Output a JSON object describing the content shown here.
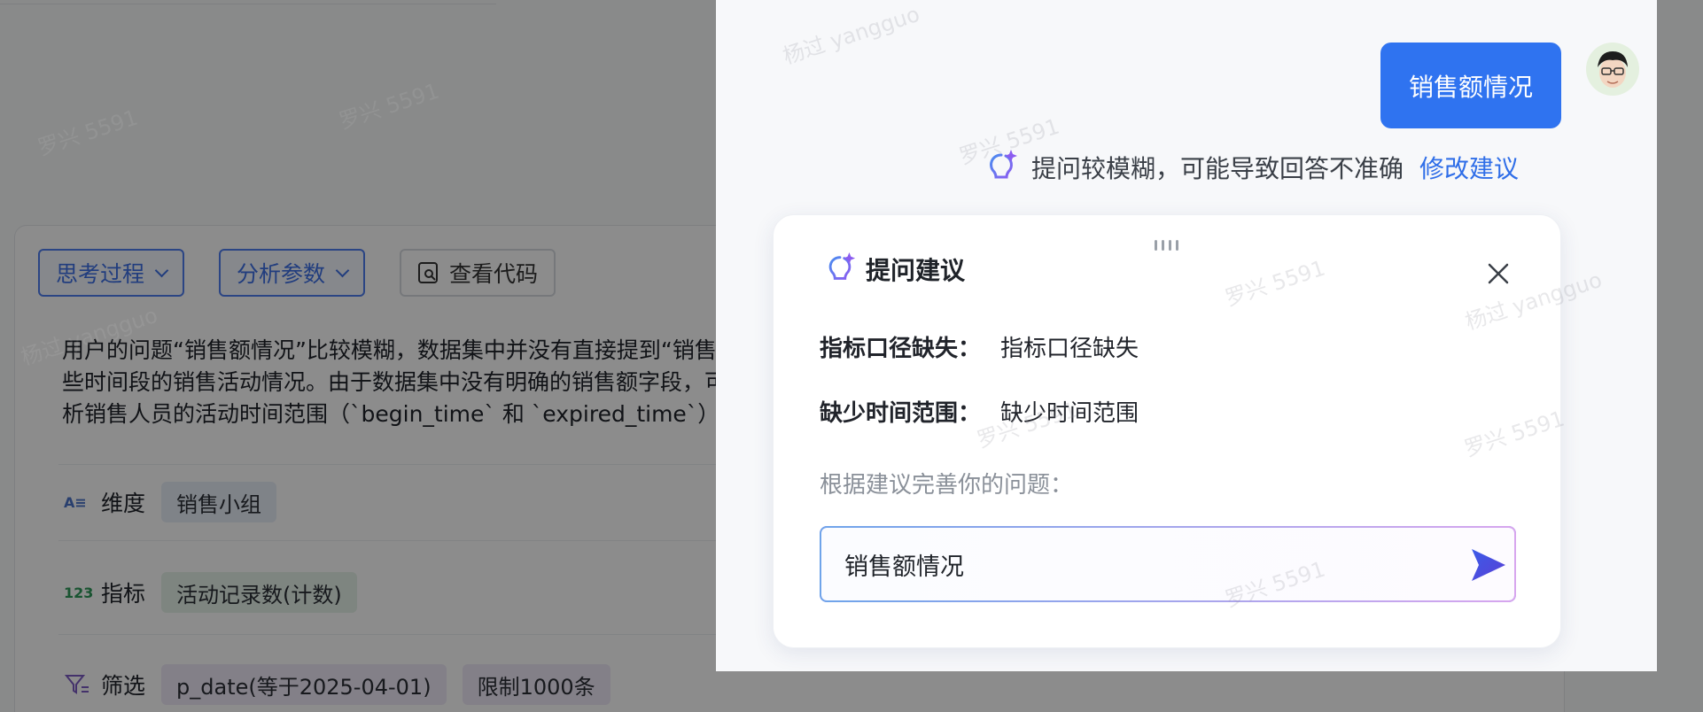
{
  "background": {
    "buttons": {
      "thinking": "思考过程",
      "params": "分析参数",
      "code": "查看代码"
    },
    "paragraph": [
      "用户的问题“销售额情况”比较模糊，数据集中并没有直接提到“销售额”",
      "些时间段的销售活动情况。由于数据集中没有明确的销售额字段，可能",
      "析销售人员的活动时间范围（`begin_time` 和 `expired_time`）或按销售"
    ],
    "rows": {
      "dimension": {
        "icon": "A≡",
        "label": "维度",
        "tag": "销售小组"
      },
      "metric": {
        "icon": "123",
        "label": "指标",
        "tag": "活动记录数(计数)"
      },
      "filter": {
        "label": "筛选",
        "tags": [
          "p_date(等于2025-04-01)",
          "限制1000条"
        ]
      }
    }
  },
  "chat": {
    "user_message": "销售额情况",
    "hint": {
      "text": "提问较模糊，可能导致回答不准确",
      "link": "修改建议"
    },
    "suggestion": {
      "title": "提问建议",
      "issues": [
        {
          "label": "指标口径缺失：",
          "value": "指标口径缺失"
        },
        {
          "label": "缺少时间范围：",
          "value": "缺少时间范围"
        }
      ],
      "prompt_label": "根据建议完善你的问题：",
      "input_value": "销售额情况"
    }
  },
  "watermark": [
    "罗兴 5591",
    "杨过 yangguo"
  ],
  "colors": {
    "primary": "#2f73f0",
    "link": "#2f6ee8",
    "pill_border": "#4f7ff1",
    "overlay": "rgba(0,0,0,0.45)"
  },
  "icons": [
    "code-view-icon",
    "chevron-down-icon",
    "dimension-icon",
    "metric-icon",
    "filter-icon",
    "lightbulb-sparkle-icon",
    "close-icon",
    "send-icon",
    "user-avatar"
  ]
}
